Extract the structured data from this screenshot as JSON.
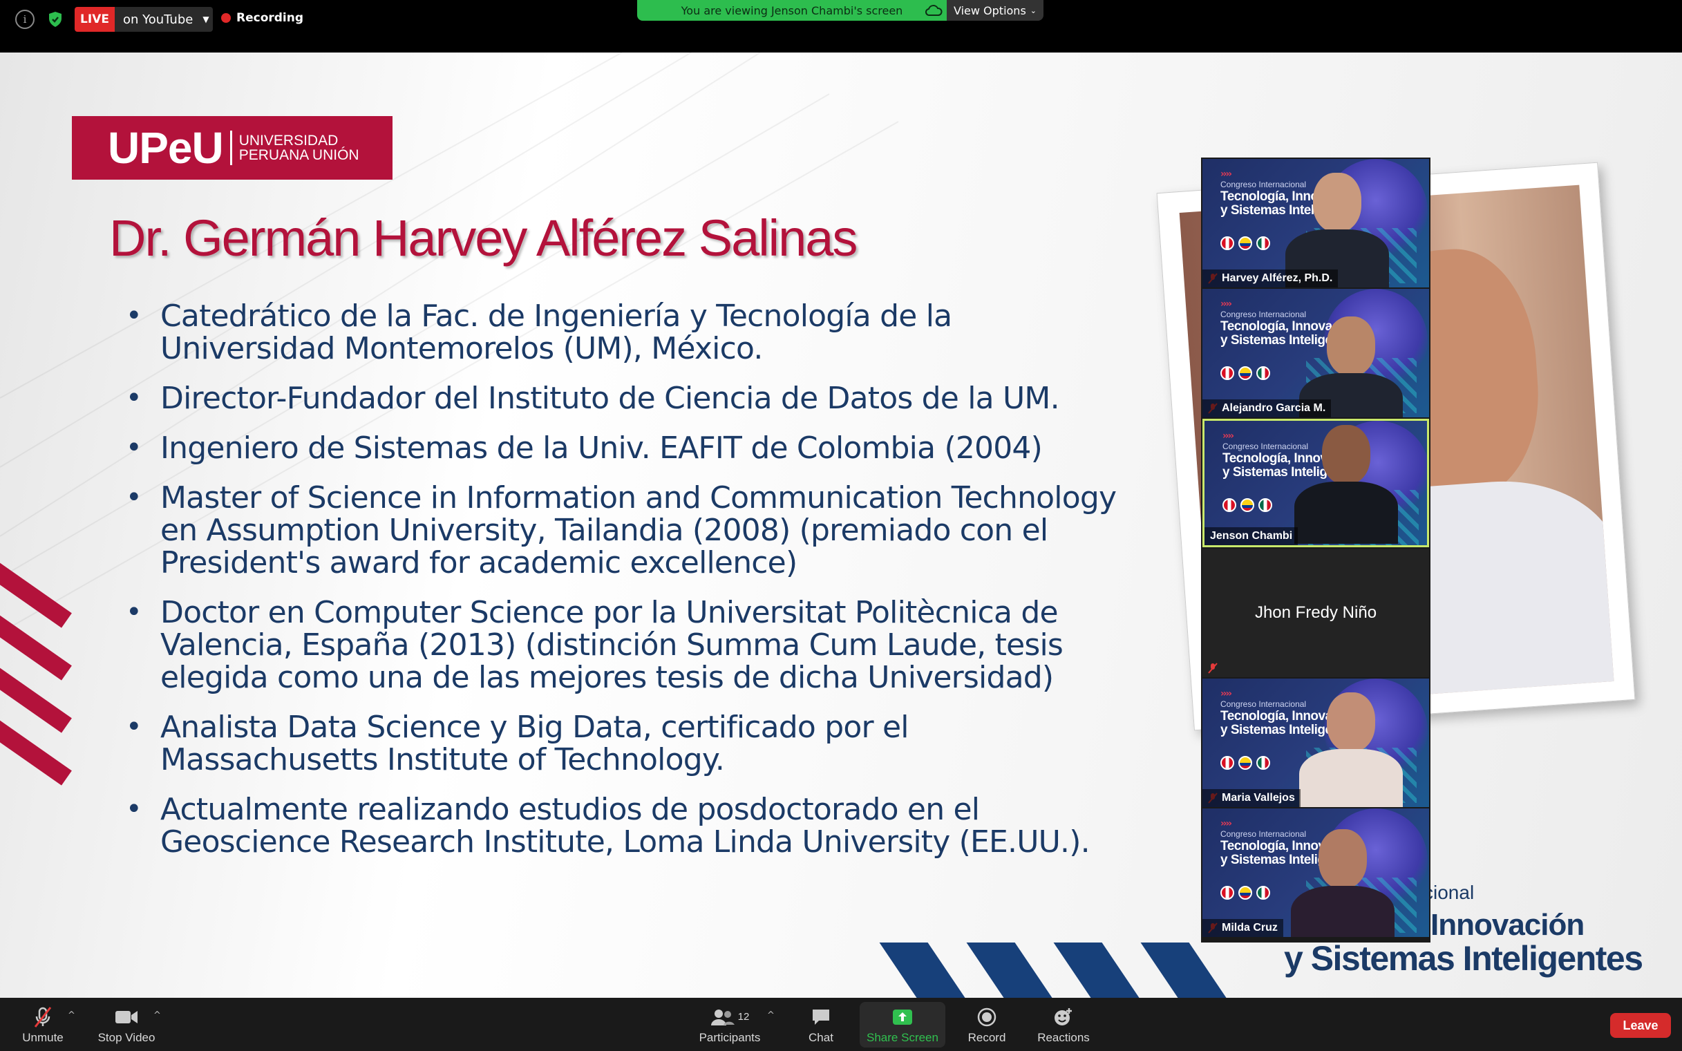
{
  "top_bar": {
    "live_label": "LIVE",
    "live_destination": "on YouTube",
    "recording_label": "Recording",
    "viewing_banner": "You are viewing Jenson Chambi's screen",
    "view_options_label": "View Options"
  },
  "slide": {
    "logo_mark": "UPeU",
    "logo_line1": "UNIVERSIDAD",
    "logo_line2": "PERUANA UNIÓN",
    "title": "Dr. Germán Harvey Alférez Salinas",
    "bullets": [
      "Catedrático de la Fac. de Ingeniería y Tecnología de la Universidad Montemorelos (UM), México.",
      "Director-Fundador del Instituto de Ciencia de Datos  de la UM.",
      "Ingeniero de Sistemas de la Univ. EAFIT de Colombia (2004)",
      "Master of Science in Information and Communication Technology en Assumption University, Tailandia (2008) (premiado con el President's award for academic excellence)",
      "Doctor en Computer Science por la Universitat Politècnica de Valencia, España (2013) (distinción Summa Cum Laude, tesis elegida como una de las mejores tesis de dicha Universidad)",
      "Analista Data Science y Big Data, certificado por el Massachusetts Institute of Technology.",
      "Actualmente realizando estudios de posdoctorado en el Geoscience Research Institute, Loma Linda University (EE.UU.)."
    ],
    "conference_small": "cional",
    "conference_line1": "Innovación",
    "conference_line2": "y Sistemas Inteligentes"
  },
  "tile_banner": {
    "congress": "Congreso Internacional",
    "line1": "Tecnología, Innovación",
    "line2": "y Sistemas Inteligentes"
  },
  "participants": [
    {
      "name": "Harvey Alférez, Ph.D.",
      "muted": true
    },
    {
      "name": "Alejandro Garcia M.",
      "muted": true
    },
    {
      "name": "Jenson Chambi",
      "muted": false,
      "active_speaker": true
    },
    {
      "name": "Jhon Fredy Niño",
      "muted": true,
      "video": false
    },
    {
      "name": "Maria Vallejos",
      "muted": true
    },
    {
      "name": "Milda Cruz",
      "muted": true
    }
  ],
  "toolbar": {
    "unmute_label": "Unmute",
    "stop_video_label": "Stop Video",
    "participants_label": "Participants",
    "participants_count": "12",
    "chat_label": "Chat",
    "share_screen_label": "Share Screen",
    "record_label": "Record",
    "reactions_label": "Reactions",
    "leave_label": "Leave"
  },
  "colors": {
    "live_red": "#e02828",
    "banner_green": "#2dbd4e",
    "brand_red": "#b3123b",
    "slide_blue": "#1b3a66",
    "share_green": "#30c04f",
    "leave_red": "#d52b2b",
    "active_border": "#c8e86b"
  }
}
